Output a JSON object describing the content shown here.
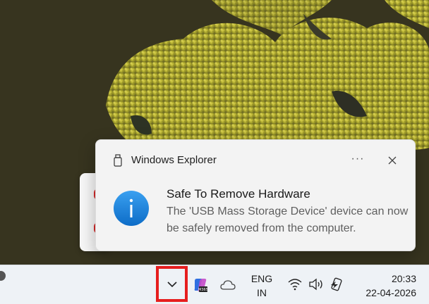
{
  "notification": {
    "app_name": "Windows Explorer",
    "more_label": "···",
    "title": "Safe To Remove Hardware",
    "body": "The 'USB Mass Storage Device' device can now be safely removed from the computer."
  },
  "taskbar": {
    "language_line1": "ENG",
    "language_line2": "IN",
    "time": "20:33",
    "date": "22-04-2026",
    "highlight_color": "#e61e1e"
  },
  "icons": {
    "app": "usb-drive-icon",
    "info": "info-icon",
    "overflow": "chevron-up-icon",
    "copilot": "copilot-icon",
    "cloud": "onedrive-icon",
    "wifi": "wifi-icon",
    "volume": "volume-icon",
    "battery": "battery-charging-icon"
  },
  "colors": {
    "info_blue": "#1a7fd8",
    "notification_bg": "#f3f3f3",
    "taskbar_bg": "#eef2f6"
  }
}
